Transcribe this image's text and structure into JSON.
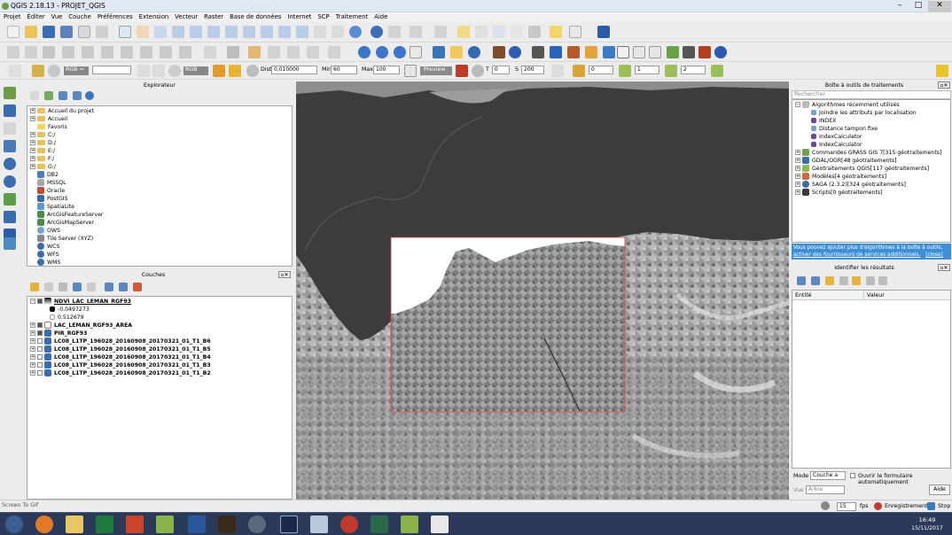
{
  "window": {
    "title": "QGIS 2.18.13 - PROJET_QGIS"
  },
  "menu": [
    "Projet",
    "Éditer",
    "Vue",
    "Couche",
    "Préférences",
    "Extension",
    "Vecteur",
    "Raster",
    "Base de données",
    "Internet",
    "SCP",
    "Traitement",
    "Aide"
  ],
  "scp_bar": {
    "rgb_label": "RGB =",
    "rgb2_label": "RGB",
    "dist_label": "Dist",
    "dist_value": "0,010000",
    "min_label": "Min",
    "min_value": "60",
    "max_label": "Max",
    "max_value": "100",
    "preview_label": "Preview",
    "t_label": "T",
    "t_value": "0",
    "s_label": "S",
    "s_value": "200",
    "v1": "0",
    "v2": "1",
    "v3": "2"
  },
  "explorer": {
    "title": "Explorateur",
    "items": [
      "Accueil du projet",
      "Accueil",
      "Favoris",
      "C:/",
      "D:/",
      "E:/",
      "F:/",
      "G:/",
      "DB2",
      "MSSQL",
      "Oracle",
      "PostGIS",
      "SpatiaLite",
      "ArcGisFeatureServer",
      "ArcGisMapServer",
      "OWS",
      "Tile Server (XYZ)",
      "WCS",
      "WFS",
      "WMS"
    ]
  },
  "layers": {
    "title": "Couches",
    "items": [
      {
        "name": "NDVI_LAC_LEMAN_RGF93",
        "checked": true,
        "underline": true
      },
      {
        "name": "-0.0497273",
        "legend": true
      },
      {
        "name": "0.512679",
        "legend": true
      },
      {
        "name": "LAC_LEMAN_RGF93_AREA",
        "checked": true
      },
      {
        "name": "PIR_RGF93",
        "checked": true
      },
      {
        "name": "LC08_L1TP_196028_20160908_20170321_01_T1_B6",
        "checked": false
      },
      {
        "name": "LC08_L1TP_196028_20160908_20170321_01_T1_B5",
        "checked": false
      },
      {
        "name": "LC08_L1TP_196028_20160908_20170321_01_T1_B4",
        "checked": false
      },
      {
        "name": "LC08_L1TP_196028_20160908_20170321_01_T1_B3",
        "checked": false
      },
      {
        "name": "LC08_L1TP_196028_20160908_20170321_01_T1_B2",
        "checked": false
      }
    ]
  },
  "processing": {
    "title": "Boîte à outils de traitements",
    "search_placeholder": "Rechercher",
    "items": [
      {
        "label": "Algorithmes récemment utilisés",
        "level": 0
      },
      {
        "label": "Joindre les attributs par localisation",
        "level": 2
      },
      {
        "label": "INDEX",
        "level": 2
      },
      {
        "label": "Distance tampon fixe",
        "level": 2
      },
      {
        "label": "IndexCalculator",
        "level": 2
      },
      {
        "label": "IndexCalculator",
        "level": 2
      },
      {
        "label": "Commandes GRASS GIS 7[315 géotraitements]",
        "level": 1
      },
      {
        "label": "GDAL/OGR[48 géotraitements]",
        "level": 1
      },
      {
        "label": "Géotraitements QGIS[117 géotraitements]",
        "level": 1
      },
      {
        "label": "Modèles[4 géotraitements]",
        "level": 1
      },
      {
        "label": "SAGA (2.3.2)[324 géotraitements]",
        "level": 1
      },
      {
        "label": "Scripts[0 géotraitements]",
        "level": 1
      }
    ],
    "info_line1": "Vous pouvez ajouter plus d'algorithmes à la boîte à outils,",
    "info_line2": "activer des fournisseurs de services additionnels.",
    "info_close": "[close]"
  },
  "identify": {
    "title": "Identifier les résultats",
    "col1": "Entité",
    "col2": "Valeur",
    "mode_label": "Mode",
    "mode_value": "Couche a",
    "open_form": "Ouvrir le formulaire automatiquement",
    "view_label": "Vue",
    "view_value": "Arbre",
    "help": "Aide"
  },
  "recorder": {
    "title": "Screen To Gif",
    "fps_value": "15",
    "fps_label": "fps",
    "record": "Enregistrement",
    "stop": "Stop"
  },
  "clock": {
    "time": "16:49",
    "date": "15/11/2017"
  }
}
